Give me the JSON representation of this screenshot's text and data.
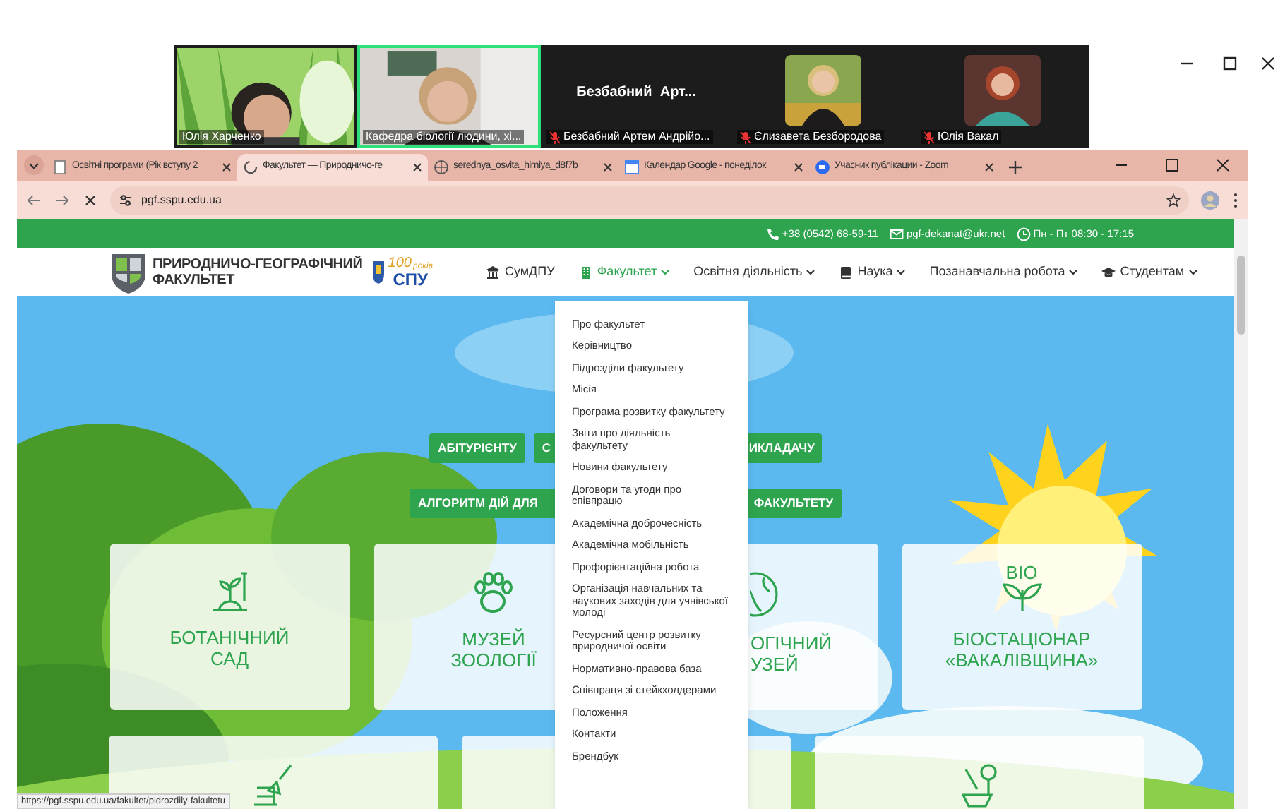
{
  "zoom_strip": {
    "participants": [
      {
        "name": "Юлія Харченко",
        "kind": "video",
        "speaking": false,
        "muted": false
      },
      {
        "name": "Кафедра біології людини, хі...",
        "kind": "video",
        "speaking": true,
        "muted": false
      },
      {
        "name": "Безбабний Артем Андрійо...",
        "display_name": "Безбабний  Арт...",
        "kind": "no_video",
        "speaking": false,
        "muted": true
      },
      {
        "name": "Єлизавета Безбородова",
        "speaking": false,
        "muted": true
      },
      {
        "name": "Юлія Вакал",
        "speaking": false,
        "muted": true
      }
    ]
  },
  "browser": {
    "tabs": [
      {
        "title": "Освітні програми (Рік вступу 2",
        "selected": false
      },
      {
        "title": "Факультет — Природничо-ге",
        "selected": true
      },
      {
        "title": "serednya_osvita_himiya_d8f7b",
        "selected": false
      },
      {
        "title": "Календар Google - понеділок",
        "selected": false
      },
      {
        "title": "Учасник публікации - Zoom",
        "selected": false
      }
    ],
    "address": "pgf.sspu.edu.ua",
    "status_url": "https://pgf.sspu.edu.ua/fakultet/pidrozdily-fakultetu"
  },
  "site": {
    "contacts": [
      {
        "kind": "phone",
        "text": "+38 (0542) 68-59-11"
      },
      {
        "kind": "email",
        "text": "pgf-dekanat@ukr.net"
      },
      {
        "kind": "clock",
        "text": "Пн - Пт 08:30 - 17:15"
      }
    ],
    "logo": {
      "title_lines": [
        "ПРИРОДНИЧО-ГЕОГРАФІЧНИЙ",
        "ФАКУЛЬТЕТ"
      ]
    },
    "anniversary_logo": {
      "number": "100",
      "script": "років",
      "name": "СПУ"
    },
    "nav": [
      {
        "label": "СумДПУ",
        "dropdown": false,
        "selected": false
      },
      {
        "label": "Факультет",
        "dropdown": true,
        "selected": true
      },
      {
        "label": "Освітня діяльність",
        "dropdown": true,
        "selected": false
      },
      {
        "label": "Наука",
        "dropdown": true,
        "selected": false
      },
      {
        "label": "Позанавчальна робота",
        "dropdown": true,
        "selected": false
      },
      {
        "label": "Студентам",
        "dropdown": true,
        "selected": false
      }
    ],
    "dropdown": [
      "Про факультет",
      "Керівництво",
      "Підрозділи факультету",
      "Місія",
      "Програма розвитку факультету",
      "Звіти про діяльність факультету",
      "Новини факультету",
      "Договори та угоди про співпрацю",
      "Академічна доброчесність",
      "Академічна мобільність",
      "Профорієнтаційна робота",
      "Організація навчальних та наукових заходів для учнівської молоді",
      "Ресурсний центр розвитку природничої освіти",
      "Нормативно-правова база",
      "Співпраця зі стейкхолдерами",
      "Положення",
      "Контакти",
      "Брендбук"
    ],
    "hero_buttons": [
      [
        "АБІТУРІЄНТУ",
        "С",
        "ИКЛАДАЧУ"
      ],
      [
        "АЛГОРИТМ ДІЙ ДЛЯ",
        "ФАКУЛЬТЕТУ"
      ]
    ],
    "cards": [
      [
        {
          "kind": "full",
          "title_lines": [
            "БОТАНІЧНИЙ",
            "САД"
          ]
        },
        {
          "kind": "full",
          "title_lines": [
            "МУЗЕЙ",
            "ЗООЛОГІЇ"
          ]
        },
        {
          "kind": "partial",
          "title_lines": [
            "ОГІЧНИЙ",
            "УЗЕЙ"
          ]
        },
        {
          "kind": "full",
          "label": "BIO",
          "title_lines": [
            "БІОСТАЦІОНАР",
            "«ВАКАЛІВЩИНА»"
          ]
        }
      ],
      [
        {
          "kind": "full"
        },
        {
          "kind": "full"
        },
        {
          "kind": "full"
        }
      ]
    ]
  }
}
